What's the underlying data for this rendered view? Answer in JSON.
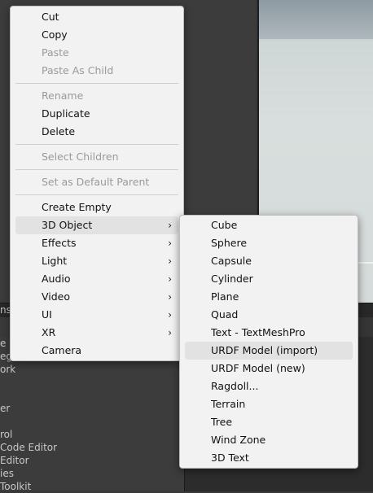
{
  "background": {
    "panel_tab_fragment": "ns",
    "hierarchy_fragments": [
      "e",
      "egi",
      "ork",
      "",
      "er",
      "",
      "rol",
      "Code Editor",
      "Editor",
      "ies",
      "Toolkit"
    ]
  },
  "context_menu": {
    "items": [
      {
        "label": "Cut",
        "enabled": true
      },
      {
        "label": "Copy",
        "enabled": true
      },
      {
        "label": "Paste",
        "enabled": false
      },
      {
        "label": "Paste As Child",
        "enabled": false
      },
      {
        "label": "Rename",
        "enabled": false
      },
      {
        "label": "Duplicate",
        "enabled": true
      },
      {
        "label": "Delete",
        "enabled": true
      },
      {
        "label": "Select Children",
        "enabled": false
      },
      {
        "label": "Set as Default Parent",
        "enabled": false
      },
      {
        "label": "Create Empty",
        "enabled": true
      },
      {
        "label": "3D Object",
        "enabled": true,
        "submenu": true,
        "highlighted": true
      },
      {
        "label": "Effects",
        "enabled": true,
        "submenu": true
      },
      {
        "label": "Light",
        "enabled": true,
        "submenu": true
      },
      {
        "label": "Audio",
        "enabled": true,
        "submenu": true
      },
      {
        "label": "Video",
        "enabled": true,
        "submenu": true
      },
      {
        "label": "UI",
        "enabled": true,
        "submenu": true
      },
      {
        "label": "XR",
        "enabled": true,
        "submenu": true
      },
      {
        "label": "Camera",
        "enabled": true
      }
    ],
    "chevron": "›"
  },
  "submenu_3d_object": {
    "items": [
      {
        "label": "Cube"
      },
      {
        "label": "Sphere"
      },
      {
        "label": "Capsule"
      },
      {
        "label": "Cylinder"
      },
      {
        "label": "Plane"
      },
      {
        "label": "Quad"
      },
      {
        "label": "Text - TextMeshPro"
      },
      {
        "label": "URDF Model (import)",
        "highlighted": true
      },
      {
        "label": "URDF Model (new)"
      },
      {
        "label": "Ragdoll..."
      },
      {
        "label": "Terrain"
      },
      {
        "label": "Tree"
      },
      {
        "label": "Wind Zone"
      },
      {
        "label": "3D Text"
      }
    ]
  },
  "colors": {
    "menu_bg": "#f2f2f2",
    "highlight": "#e2e2e2",
    "disabled_text": "#9a9a9a"
  }
}
